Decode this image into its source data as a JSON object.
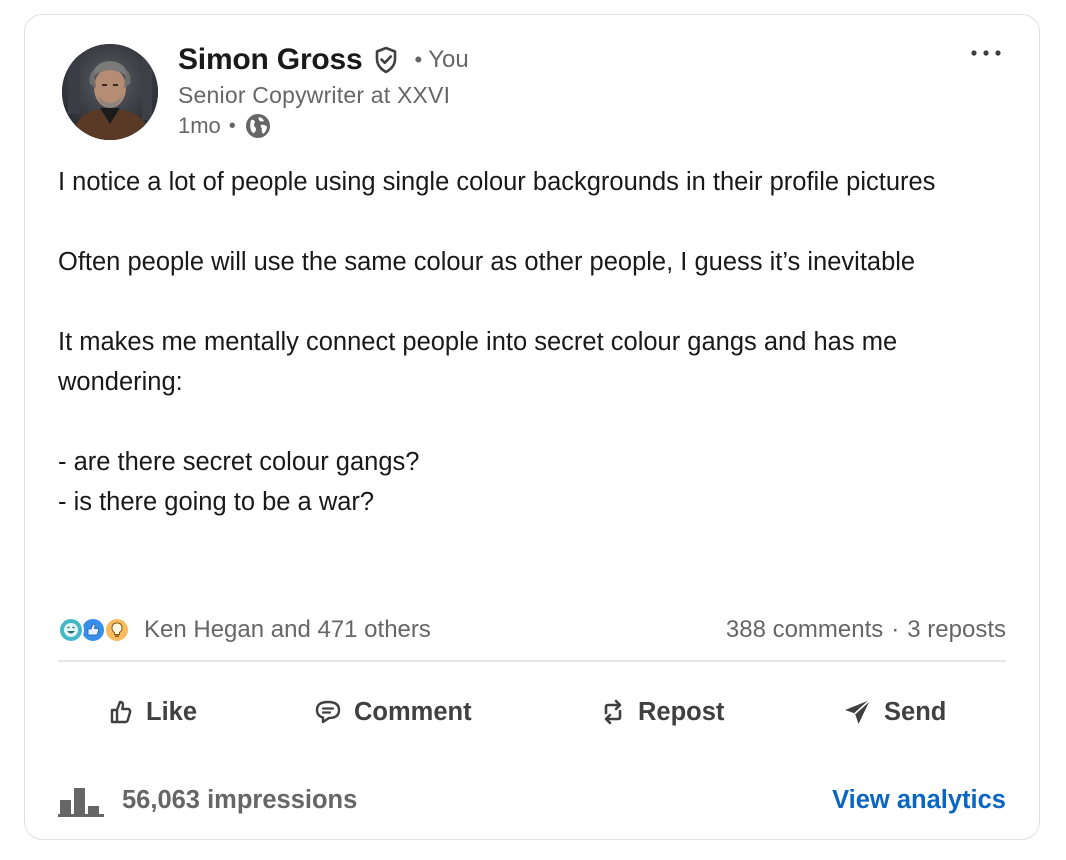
{
  "author": {
    "name": "Simon Gross",
    "relation": "You",
    "headline": "Senior Copywriter at XXVI",
    "time": "1mo",
    "visibility_icon": "globe-icon"
  },
  "post": {
    "paragraphs": [
      "I notice a lot of people using single colour backgrounds in their profile pictures",
      "Often people will use the same colour as other people, I guess it’s inevitable",
      "It makes me mentally connect people into secret colour gangs and has me wondering:",
      "- are there secret colour gangs?\n- is there going to be a war?"
    ]
  },
  "social": {
    "reaction_icons": [
      "funny-icon",
      "like-icon",
      "insightful-icon"
    ],
    "reactions_text": "Ken Hegan and 471 others",
    "comments": "388 comments",
    "separator": "·",
    "reposts": "3 reposts"
  },
  "actions": {
    "like": "Like",
    "comment": "Comment",
    "repost": "Repost",
    "send": "Send"
  },
  "footer": {
    "impressions": "56,063 impressions",
    "analytics_link": "View analytics"
  },
  "colors": {
    "link_blue": "#0a66c2",
    "text_primary": "#191919",
    "text_secondary": "#666666"
  }
}
